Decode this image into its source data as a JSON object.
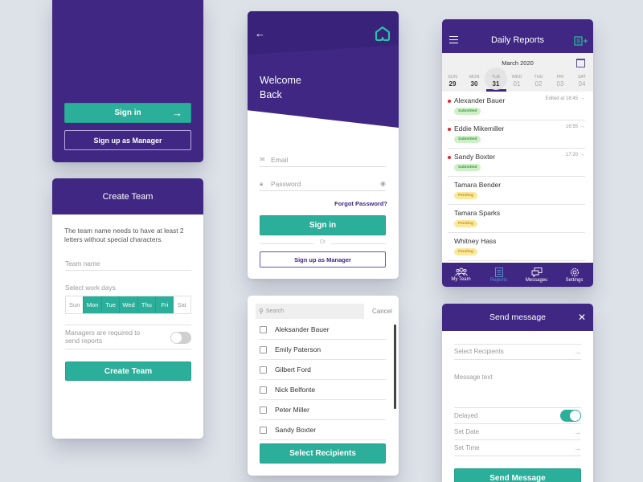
{
  "welcome_screen": {
    "sign_in_label": "Sign in",
    "sign_up_manager_label": "Sign up as Manager"
  },
  "create_team": {
    "title": "Create Team",
    "description": "The team name needs to have at least 2 letters without special characters.",
    "team_name_placeholder": "Team name",
    "work_days_label": "Select work days",
    "days": [
      {
        "label": "Sun",
        "selected": false
      },
      {
        "label": "Mon",
        "selected": true
      },
      {
        "label": "Tue",
        "selected": true
      },
      {
        "label": "Wed",
        "selected": true
      },
      {
        "label": "Thu",
        "selected": true
      },
      {
        "label": "Fri",
        "selected": true
      },
      {
        "label": "Sat",
        "selected": false
      }
    ],
    "managers_required_label": "Managers are required to send reports",
    "managers_required_on": false,
    "create_button": "Create Team"
  },
  "login": {
    "title_line1": "Welcome",
    "title_line2": "Back",
    "email_placeholder": "Email",
    "password_placeholder": "Password",
    "forgot_password": "Forgot Password?",
    "sign_in_label": "Sign in",
    "or_label": "Or",
    "sign_up_manager_label": "Sign up as Manager",
    "accent_color": "#2bae9a"
  },
  "recipients": {
    "search_placeholder": "Search",
    "cancel_label": "Cancel",
    "items": [
      {
        "name": "Aleksander Bauer",
        "checked": false
      },
      {
        "name": "Emily Paterson",
        "checked": false
      },
      {
        "name": "Gilbert Ford",
        "checked": false
      },
      {
        "name": "Nick Belfonte",
        "checked": false
      },
      {
        "name": "Peter Miller",
        "checked": false
      },
      {
        "name": "Sandy Boxter",
        "checked": false
      }
    ],
    "select_button": "Select Recipients"
  },
  "daily_reports": {
    "title": "Daily Reports",
    "month": "March 2020",
    "week": [
      {
        "name": "SUN",
        "day": "29"
      },
      {
        "name": "MON",
        "day": "30"
      },
      {
        "name": "TUE",
        "day": "31"
      },
      {
        "name": "WED",
        "day": "01"
      },
      {
        "name": "THU",
        "day": "02"
      },
      {
        "name": "FRI",
        "day": "03"
      },
      {
        "name": "SAT",
        "day": "04"
      }
    ],
    "selected_day": "31",
    "reports": [
      {
        "name": "Alexander Bauer",
        "status": "Submitted",
        "time": "Edited at 18:45",
        "unread": true
      },
      {
        "name": "Eddie Mikemiller",
        "status": "Submitted",
        "time": "16:55",
        "unread": true
      },
      {
        "name": "Sandy Boxter",
        "status": "Submitted",
        "time": "17:20",
        "unread": true
      },
      {
        "name": "Tamara Bender",
        "status": "Pending",
        "time": "",
        "unread": false
      },
      {
        "name": "Tamara Sparks",
        "status": "Pending",
        "time": "",
        "unread": false
      },
      {
        "name": "Whitney Hass",
        "status": "Pending",
        "time": "",
        "unread": false
      }
    ],
    "nav": [
      {
        "label": "My Team",
        "icon": "team-icon",
        "active": false
      },
      {
        "label": "Reports",
        "icon": "reports-icon",
        "active": true
      },
      {
        "label": "Messages",
        "icon": "messages-icon",
        "active": false
      },
      {
        "label": "Settings",
        "icon": "settings-icon",
        "active": false
      }
    ]
  },
  "send_message": {
    "title": "Send message",
    "select_recipients": "Select Recipients",
    "message_placeholder": "Message text",
    "delayed_label": "Delayed",
    "delayed_on": true,
    "set_date": "Set Date",
    "set_time": "Set Time",
    "send_button": "Send Message"
  },
  "colors": {
    "primary": "#3f2783",
    "accent": "#2bae9a",
    "submitted": "#cfefc8",
    "pending": "#fbe89a",
    "unread_dot": "#e8202a"
  }
}
